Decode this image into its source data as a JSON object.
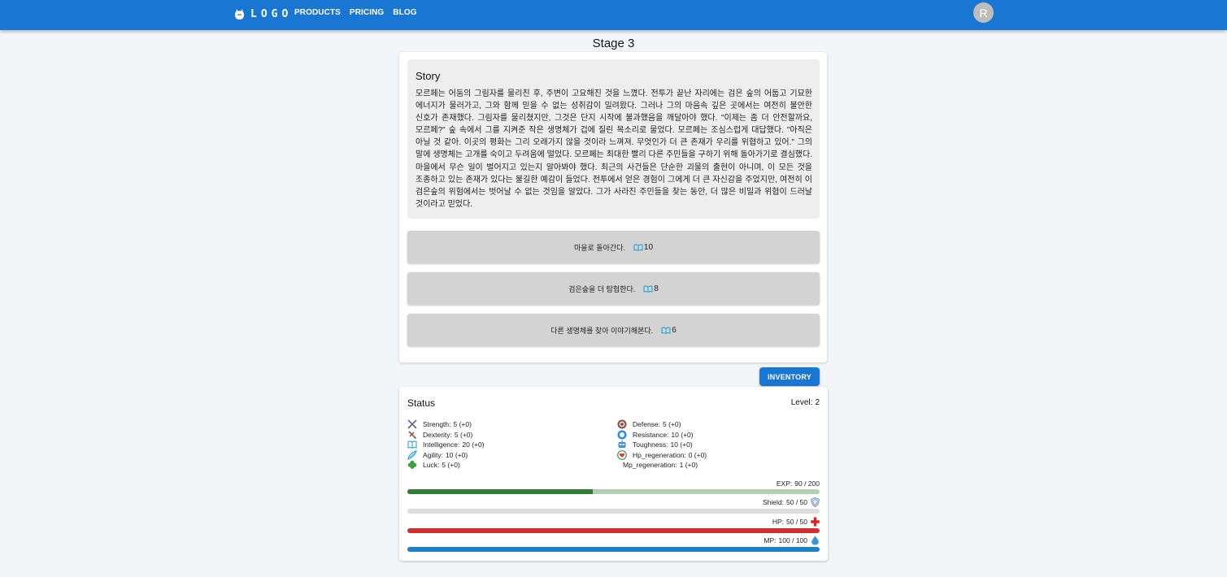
{
  "appbar": {
    "logo_text": "LOGO",
    "nav": [
      "PRODUCTS",
      "PRICING",
      "BLOG"
    ],
    "avatar_initial": "R",
    "color": "#1976d2"
  },
  "stage": {
    "title": "Stage 3"
  },
  "story": {
    "title": "Story",
    "text": "모르페는 어둠의 그림자를 물리친 후, 주변이 고요해진 것을 느꼈다. 전투가 끝난 자리에는 검은 숲의 어둡고 기묘한 에너지가 물러가고, 그와 함께 믿을 수 없는 성취감이 밀려왔다. 그러나 그의 마음속 깊은 곳에서는 여전히 불안한 신호가 존재했다. 그림자를 물리쳤지만, 그것은 단지 시작에 불과했음을 깨달아야 했다. \"이제는 좀 더 안전할까요, 모르페?\" 숲 속에서 그를 지켜준 작은 생명체가 겁에 질린 목소리로 물었다. 모르페는 조심스럽게 대답했다. \"아직은 아닐 것 같아. 이곳의 평화는 그리 오래가지 않을 것이라 느껴져. 무엇인가 더 큰 존재가 우리를 위협하고 있어.\" 그의 말에 생명체는 고개를 숙이고 두려움에 떨었다. 모르페는 최대한 빨리 다른 주민들을 구하기 위해 돌아가기로 결심했다. 마을에서 무슨 일이 벌어지고 있는지 알아봐야 했다. 최근의 사건들은 단순한 괴물의 출현이 아니며, 이 모든 것을 조종하고 있는 존재가 있다는 불길한 예감이 들었다. 전투에서 얻은 경험이 그에게 더 큰 자신감을 주었지만, 여전히 이 검은숲의 위험에서는 벗어날 수 없는 것임을 알았다. 그가 사라진 주민들을 찾는 동안, 더 많은 비밀과 위협이 드러날 것이라고 믿었다."
  },
  "choices": [
    {
      "label": "마을로 돌아간다.",
      "cost": "10",
      "icon": "book-icon"
    },
    {
      "label": "검은숲을 더 탐험한다.",
      "cost": "8",
      "icon": "book-icon"
    },
    {
      "label": "다른 생명체를 찾아 이야기해본다.",
      "cost": "6",
      "icon": "book-icon"
    }
  ],
  "inventory_label": "INVENTORY",
  "status": {
    "title": "Status",
    "level_label": "Level:",
    "level_value": "2",
    "stats_left": [
      {
        "name": "Strength:",
        "value": "5 (+0)",
        "icon": "crossed-swords-icon"
      },
      {
        "name": "Dexterity:",
        "value": "5 (+0)",
        "icon": "dagger-icon"
      },
      {
        "name": "Intelligence:",
        "value": "20 (+0)",
        "icon": "book-icon"
      },
      {
        "name": "Agility:",
        "value": "10 (+0)",
        "icon": "wing-icon"
      },
      {
        "name": "Luck:",
        "value": "5 (+0)",
        "icon": "clover-icon"
      }
    ],
    "stats_right": [
      {
        "name": "Defense:",
        "value": "5 (+0)",
        "icon": "target-shield-icon"
      },
      {
        "name": "Resistance:",
        "value": "10 (+0)",
        "icon": "orb-icon"
      },
      {
        "name": "Toughness:",
        "value": "10 (+0)",
        "icon": "robot-icon"
      },
      {
        "name": "Hp_regeneration:",
        "value": "0 (+0)",
        "icon": "heart-regen-icon"
      },
      {
        "name": "Mp_regeneration:",
        "value": "1 (+0)",
        "icon": ""
      }
    ],
    "bars": {
      "exp": {
        "label": "EXP:",
        "current": 90,
        "max": 200,
        "text": "90 / 200",
        "fill_color": "#2e7d32",
        "track_color": "#b2ceb3"
      },
      "shield": {
        "label": "Shield:",
        "current": 50,
        "max": 50,
        "text": "50 / 50",
        "fill_color": "#dcdcdc",
        "track_color": "#dcdcdc",
        "icon": "shield-icon"
      },
      "hp": {
        "label": "HP:",
        "current": 50,
        "max": 50,
        "text": "50 / 50",
        "fill_color": "#d32f2f",
        "track_color": "#f2b8b8",
        "icon": "red-cross-icon"
      },
      "mp": {
        "label": "MP:",
        "current": 100,
        "max": 100,
        "text": "100 / 100",
        "fill_color": "#1a82c9",
        "track_color": "#a9cfe9",
        "icon": "water-drop-icon"
      }
    }
  }
}
